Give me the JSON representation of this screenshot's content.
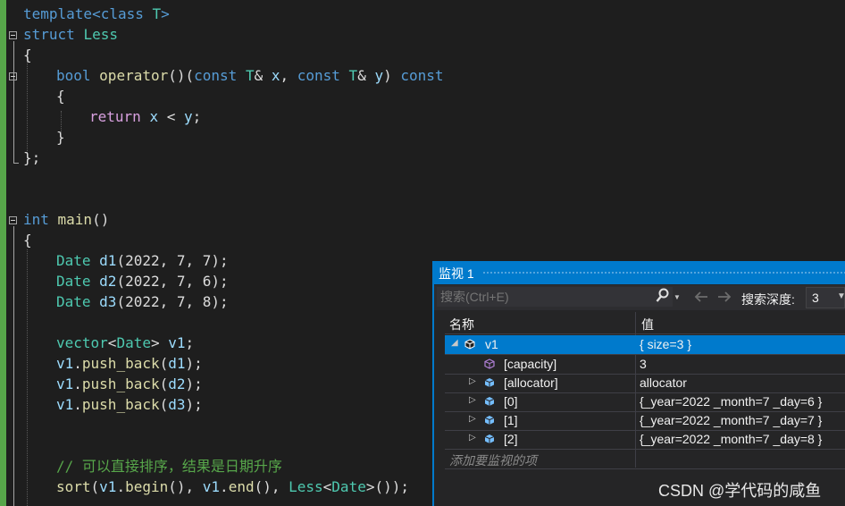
{
  "editor": {
    "lines": {
      "l1": {
        "a": "template<class ",
        "b": "T",
        "c": ">"
      },
      "l2": {
        "a": "struct ",
        "b": "Less"
      },
      "l3": {
        "a": "{"
      },
      "l4": {
        "a": "bool ",
        "b": "operator",
        "c": "()(",
        "d": "const ",
        "e": "T",
        "f": "& ",
        "g": "x",
        "h": ", ",
        "i": "const ",
        "j": "T",
        "k": "& ",
        "l": "y",
        "m": ") ",
        "n": "const"
      },
      "l5": {
        "a": "{"
      },
      "l6": {
        "a": "return ",
        "b": "x",
        "c": " < ",
        "d": "y",
        "e": ";"
      },
      "l7": {
        "a": "}"
      },
      "l8": {
        "a": "};"
      },
      "l9": {
        "a": "int ",
        "b": "main",
        "c": "()"
      },
      "l10": {
        "a": "{"
      },
      "l11": {
        "a": "Date ",
        "b": "d1",
        "c": "(2022, 7, 7);"
      },
      "l12": {
        "a": "Date ",
        "b": "d2",
        "c": "(2022, 7, 6);"
      },
      "l13": {
        "a": "Date ",
        "b": "d3",
        "c": "(2022, 7, 8);"
      },
      "l14": {
        "a": "vector",
        "b": "<",
        "c": "Date",
        "d": "> ",
        "e": "v1",
        "f": ";"
      },
      "l15": {
        "a": "v1",
        "b": ".",
        "c": "push_back",
        "d": "(",
        "e": "d1",
        "f": ");"
      },
      "l16": {
        "a": "v1",
        "b": ".",
        "c": "push_back",
        "d": "(",
        "e": "d2",
        "f": ");"
      },
      "l17": {
        "a": "v1",
        "b": ".",
        "c": "push_back",
        "d": "(",
        "e": "d3",
        "f": ");"
      },
      "l18": {
        "a": "// 可以直接排序，结果是日期升序"
      },
      "l19": {
        "a": "sort",
        "b": "(",
        "c": "v1",
        "d": ".",
        "e": "begin",
        "f": "(), ",
        "g": "v1",
        "h": ".",
        "i": "end",
        "j": "(), ",
        "k": "Less",
        "l": "<",
        "m": "Date",
        "n": ">",
        "o": "());"
      }
    }
  },
  "watch": {
    "title": "监视 1",
    "search_placeholder": "搜索(Ctrl+E)",
    "search_icon": "search-icon",
    "back_icon": "arrow-left-icon",
    "forward_icon": "arrow-right-icon",
    "depth_label": "搜索深度:",
    "depth_value": "3",
    "columns": {
      "name": "名称",
      "value": "值"
    },
    "rows": [
      {
        "name": "v1",
        "value": "{ size=3 }",
        "selected": true,
        "expanded": true
      },
      {
        "name": "[capacity]",
        "value": "3"
      },
      {
        "name": "[allocator]",
        "value": "allocator"
      },
      {
        "name": "[0]",
        "value": "{_year=2022 _month=7 _day=6 }"
      },
      {
        "name": "[1]",
        "value": "{_year=2022 _month=7 _day=7 }"
      },
      {
        "name": "[2]",
        "value": "{_year=2022 _month=7 _day=8 }"
      }
    ],
    "add_placeholder": "添加要监视的项"
  },
  "watermark": "CSDN @学代码的咸鱼",
  "colors": {
    "keyword": "#569cd6",
    "type": "#4ec9b0",
    "function": "#dcdcaa",
    "param": "#9cdcfe",
    "comment": "#57a64a",
    "control": "#d8a0df",
    "selection": "#007acc"
  }
}
